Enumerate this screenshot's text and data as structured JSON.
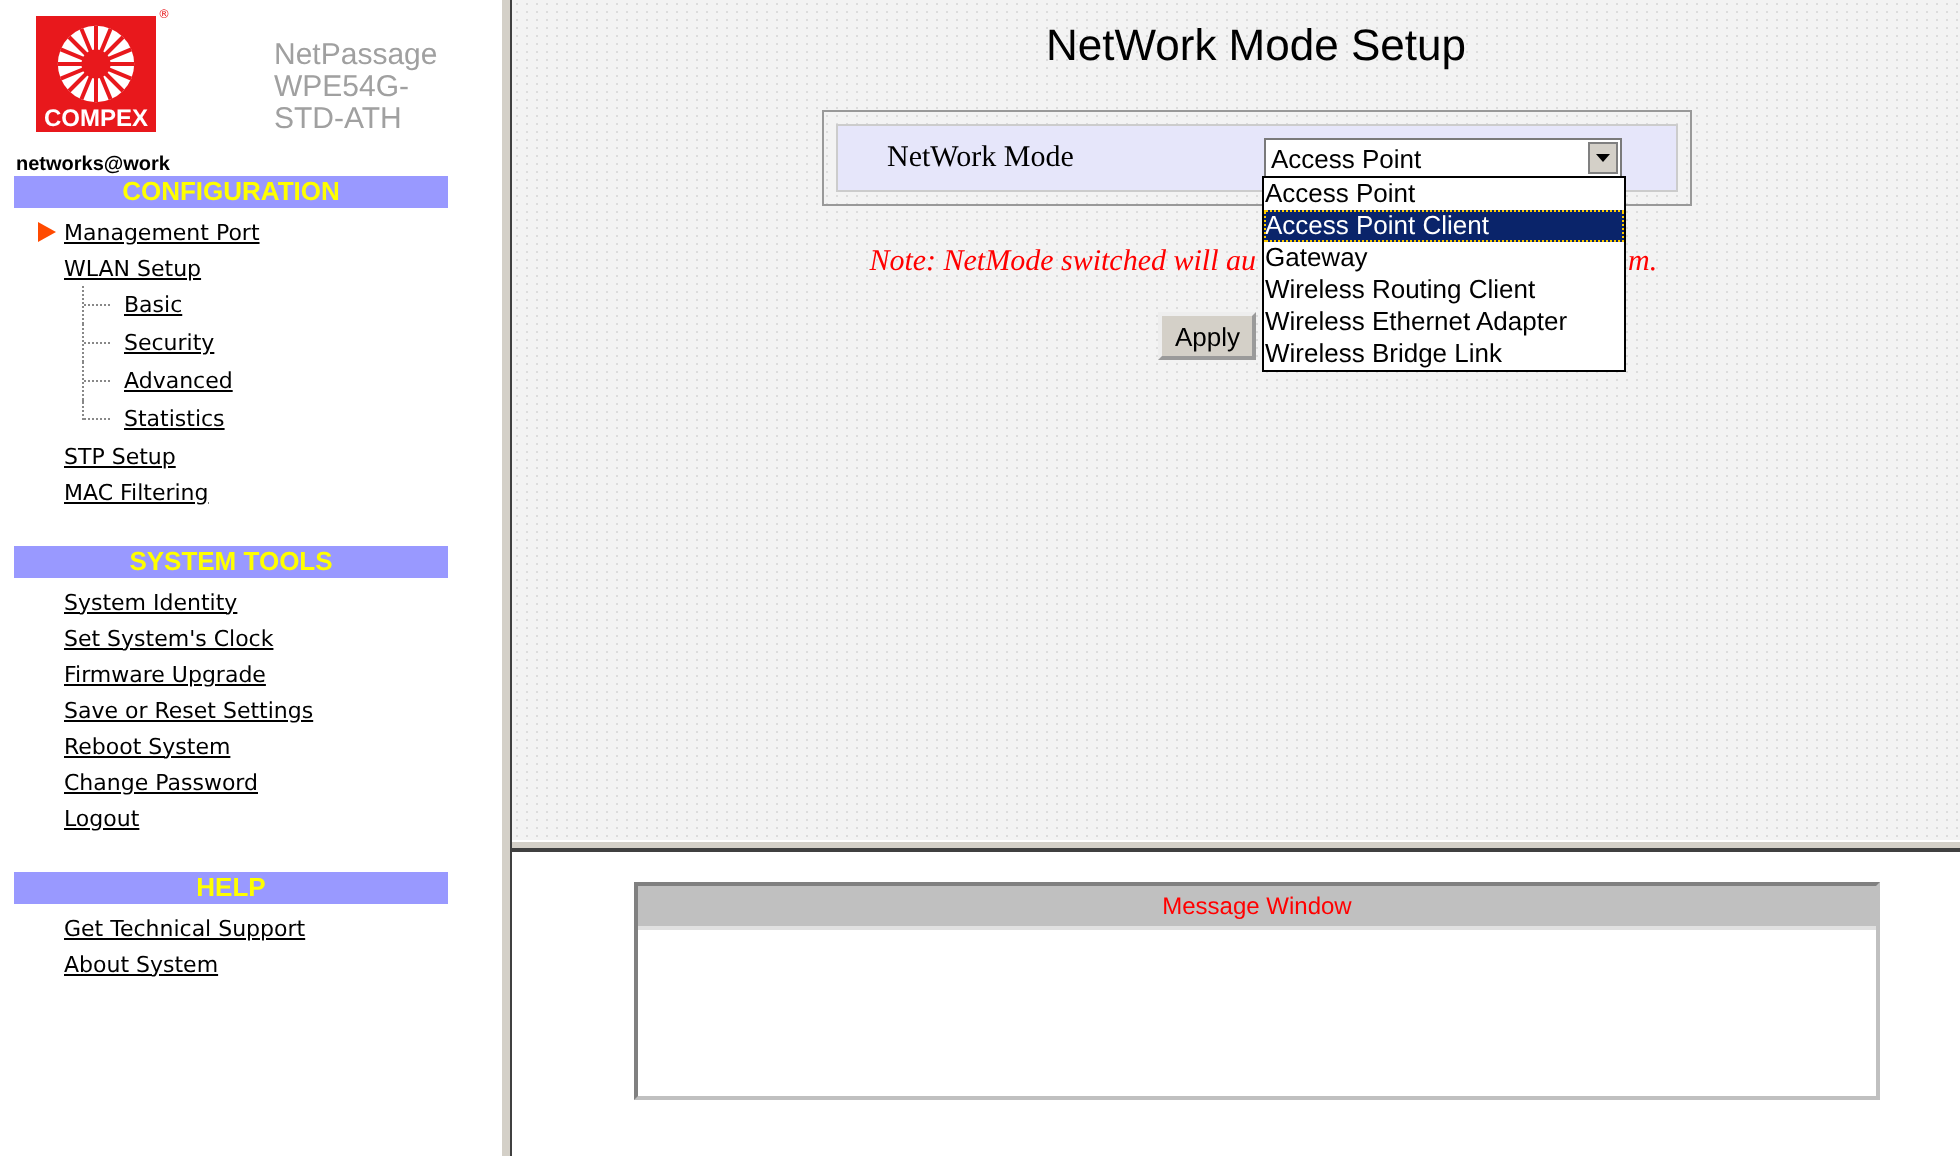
{
  "sidebar": {
    "brand": {
      "logo_text": "COMPEX",
      "registered": "®",
      "product": [
        "NetPassage",
        "WPE54G-",
        "STD-ATH"
      ],
      "tagline": "networks@work"
    },
    "sections": [
      {
        "title": "CONFIGURATION",
        "items": [
          {
            "label": "Management Port",
            "selected": true
          },
          {
            "label": "WLAN Setup",
            "selected": false,
            "children": [
              {
                "label": "Basic",
                "selected": false
              },
              {
                "label": "Security",
                "selected": false
              },
              {
                "label": "Advanced",
                "selected": false
              },
              {
                "label": "Statistics",
                "selected": false
              }
            ]
          },
          {
            "label": "STP Setup",
            "selected": false
          },
          {
            "label": "MAC Filtering",
            "selected": false
          }
        ]
      },
      {
        "title": "SYSTEM TOOLS",
        "items": [
          {
            "label": "System Identity",
            "selected": false
          },
          {
            "label": "Set System's Clock",
            "selected": false
          },
          {
            "label": "Firmware Upgrade",
            "selected": false
          },
          {
            "label": "Save or Reset Settings",
            "selected": false
          },
          {
            "label": "Reboot System",
            "selected": false
          },
          {
            "label": "Change Password",
            "selected": false
          },
          {
            "label": "Logout",
            "selected": false
          }
        ]
      },
      {
        "title": "HELP",
        "items": [
          {
            "label": "Get Technical Support",
            "selected": false
          },
          {
            "label": "About System",
            "selected": false
          }
        ]
      }
    ]
  },
  "main": {
    "title": "NetWork Mode Setup",
    "field_label": "NetWork Mode",
    "select": {
      "value": "Access Point",
      "expanded": true,
      "options": [
        {
          "label": "Access Point",
          "highlighted": false
        },
        {
          "label": "Access Point Client",
          "highlighted": true
        },
        {
          "label": "Gateway",
          "highlighted": false
        },
        {
          "label": "Wireless Routing Client",
          "highlighted": false
        },
        {
          "label": "Wireless Ethernet Adapter",
          "highlighted": false
        },
        {
          "label": "Wireless Bridge Link",
          "highlighted": false
        }
      ]
    },
    "note_start": "Note: NetMode switched will au",
    "note_end": "m.",
    "apply_button": "Apply"
  },
  "message_window": {
    "title": "Message Window"
  }
}
